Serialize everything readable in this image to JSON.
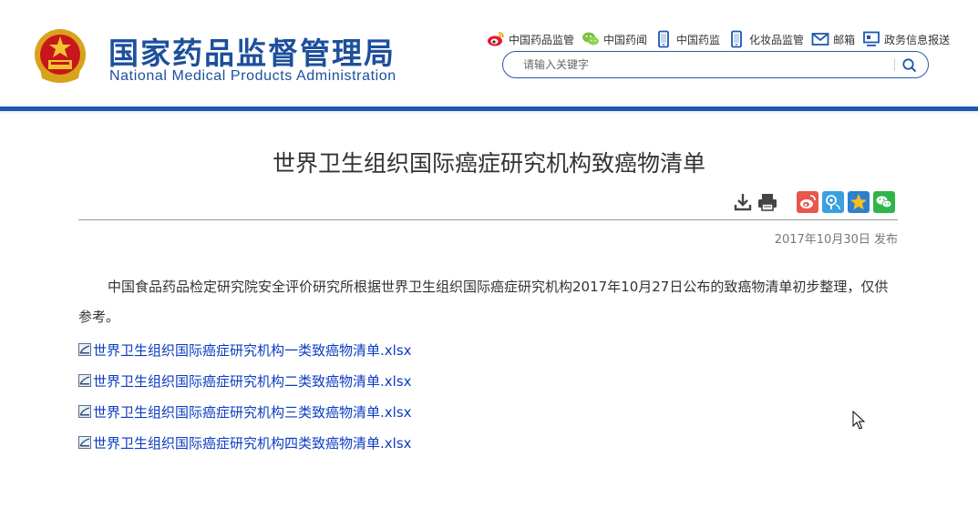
{
  "header": {
    "logo_cn": "国家药品监督管理局",
    "logo_en": "National Medical Products Administration",
    "links": [
      {
        "label": "中国药品监管",
        "icon": "weibo-icon"
      },
      {
        "label": "中国药闻",
        "icon": "wechat-icon"
      },
      {
        "label": "中国药监",
        "icon": "mobile-icon"
      },
      {
        "label": "化妆品监管",
        "icon": "mobile-icon"
      },
      {
        "label": "邮箱",
        "icon": "mail-icon"
      },
      {
        "label": "政务信息报送",
        "icon": "monitor-icon"
      }
    ],
    "search": {
      "placeholder": "请输入关键字"
    }
  },
  "article": {
    "title": "世界卫生组织国际癌症研究机构致癌物清单",
    "date": "2017年10月30日 发布",
    "paragraph": "中国食品药品检定研究院安全评价研究所根据世界卫生组织国际癌症研究机构2017年10月27日公布的致癌物清单初步整理，仅供参考。",
    "files": [
      "世界卫生组织国际癌症研究机构一类致癌物清单.xlsx",
      "世界卫生组织国际癌症研究机构二类致癌物清单.xlsx",
      "世界卫生组织国际癌症研究机构三类致癌物清单.xlsx",
      "世界卫生组织国际癌症研究机构四类致癌物清单.xlsx"
    ]
  },
  "tools": [
    "download-icon",
    "print-icon",
    "share-weibo-icon",
    "share-qq-icon",
    "share-qzone-icon",
    "share-wechat-icon"
  ],
  "colors": {
    "brand": "#1d4f9c",
    "bar": "#1d57b0",
    "link": "#0b3cc1"
  }
}
